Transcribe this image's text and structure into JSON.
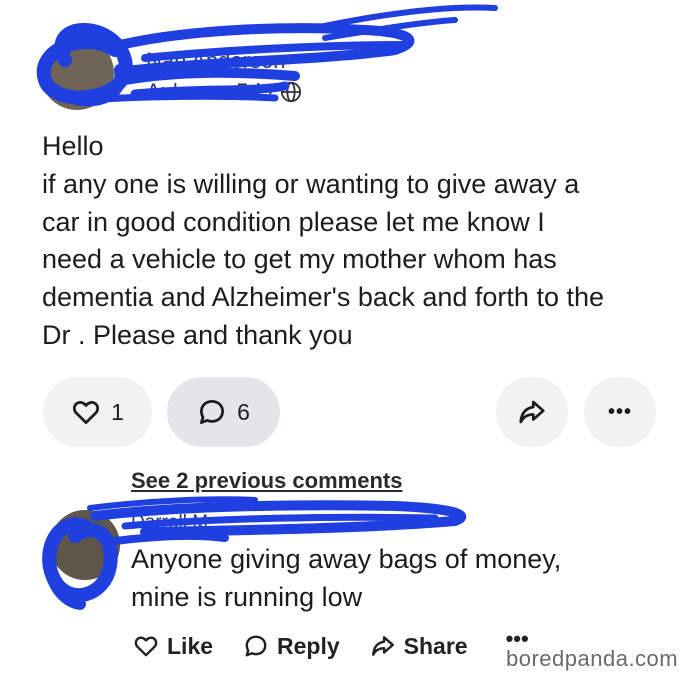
{
  "post": {
    "author_name": "Nan Anderson",
    "location": "Auburn",
    "age": "5d",
    "separator": "·",
    "body": "Hello\nif  any one is willing or wanting to give away a\ncar in good condition please let me know I\nneed a vehicle to get my mother whom has\ndementia and Alzheimer's back and forth to the\nDr . Please and thank you"
  },
  "actions": {
    "like_count": "1",
    "comment_count": "6",
    "more_label": "•••"
  },
  "comments": {
    "see_previous": "See 2 previous comments",
    "comment": {
      "author_name": "Darrell M",
      "text": "Anyone giving away bags of money,\nmine is running low",
      "like_label": "Like",
      "reply_label": "Reply",
      "share_label": "Share",
      "more_label": "•••"
    }
  },
  "watermark": "boredpanda.com",
  "icons": {
    "globe": "globe-icon",
    "heart": "heart-icon",
    "comment": "comment-bubble-icon",
    "share": "share-arrow-icon",
    "more": "more-dots-icon"
  },
  "colors": {
    "scribble": "#1f3fe0",
    "button_bg": "#f0f2f4",
    "button_active_bg": "#e2e6ea",
    "text": "#1d1d1f"
  }
}
